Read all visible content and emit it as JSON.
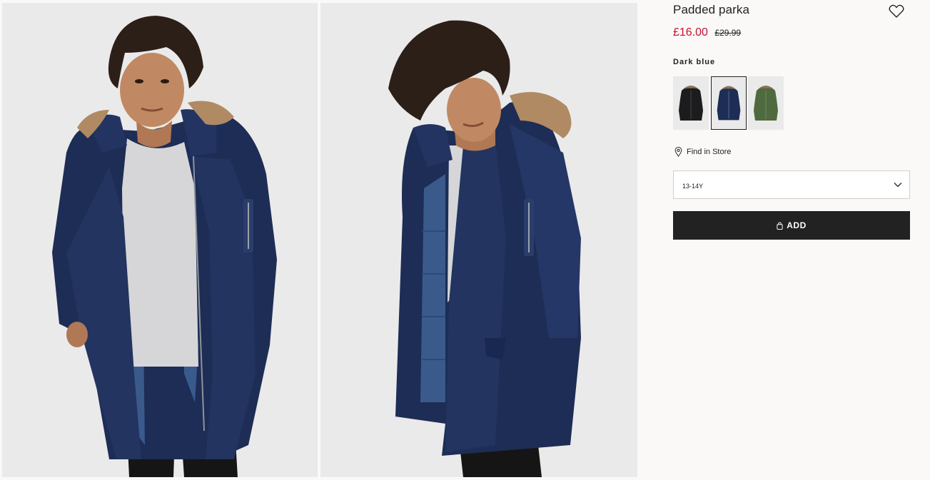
{
  "product": {
    "title": "Padded parka",
    "price_current": "£16.00",
    "price_original": "£29.99",
    "color_selected": "Dark blue"
  },
  "swatches": [
    {
      "color": "black",
      "hex": "#1c1c1e"
    },
    {
      "color": "dark-blue",
      "hex": "#1d2d55"
    },
    {
      "color": "khaki-green",
      "hex": "#4f6a3e"
    }
  ],
  "store": {
    "label": "Find in Store"
  },
  "size": {
    "selected": "13-14Y"
  },
  "cta": {
    "label": "ADD"
  },
  "colors": {
    "price_sale": "#c8102e",
    "button_bg": "#222222",
    "coat_navy": "#1d2d55"
  },
  "icons": {
    "favorite": "heart-outline-icon",
    "store": "location-pin-icon",
    "dropdown": "chevron-down-icon",
    "cart": "shopping-bag-icon"
  }
}
